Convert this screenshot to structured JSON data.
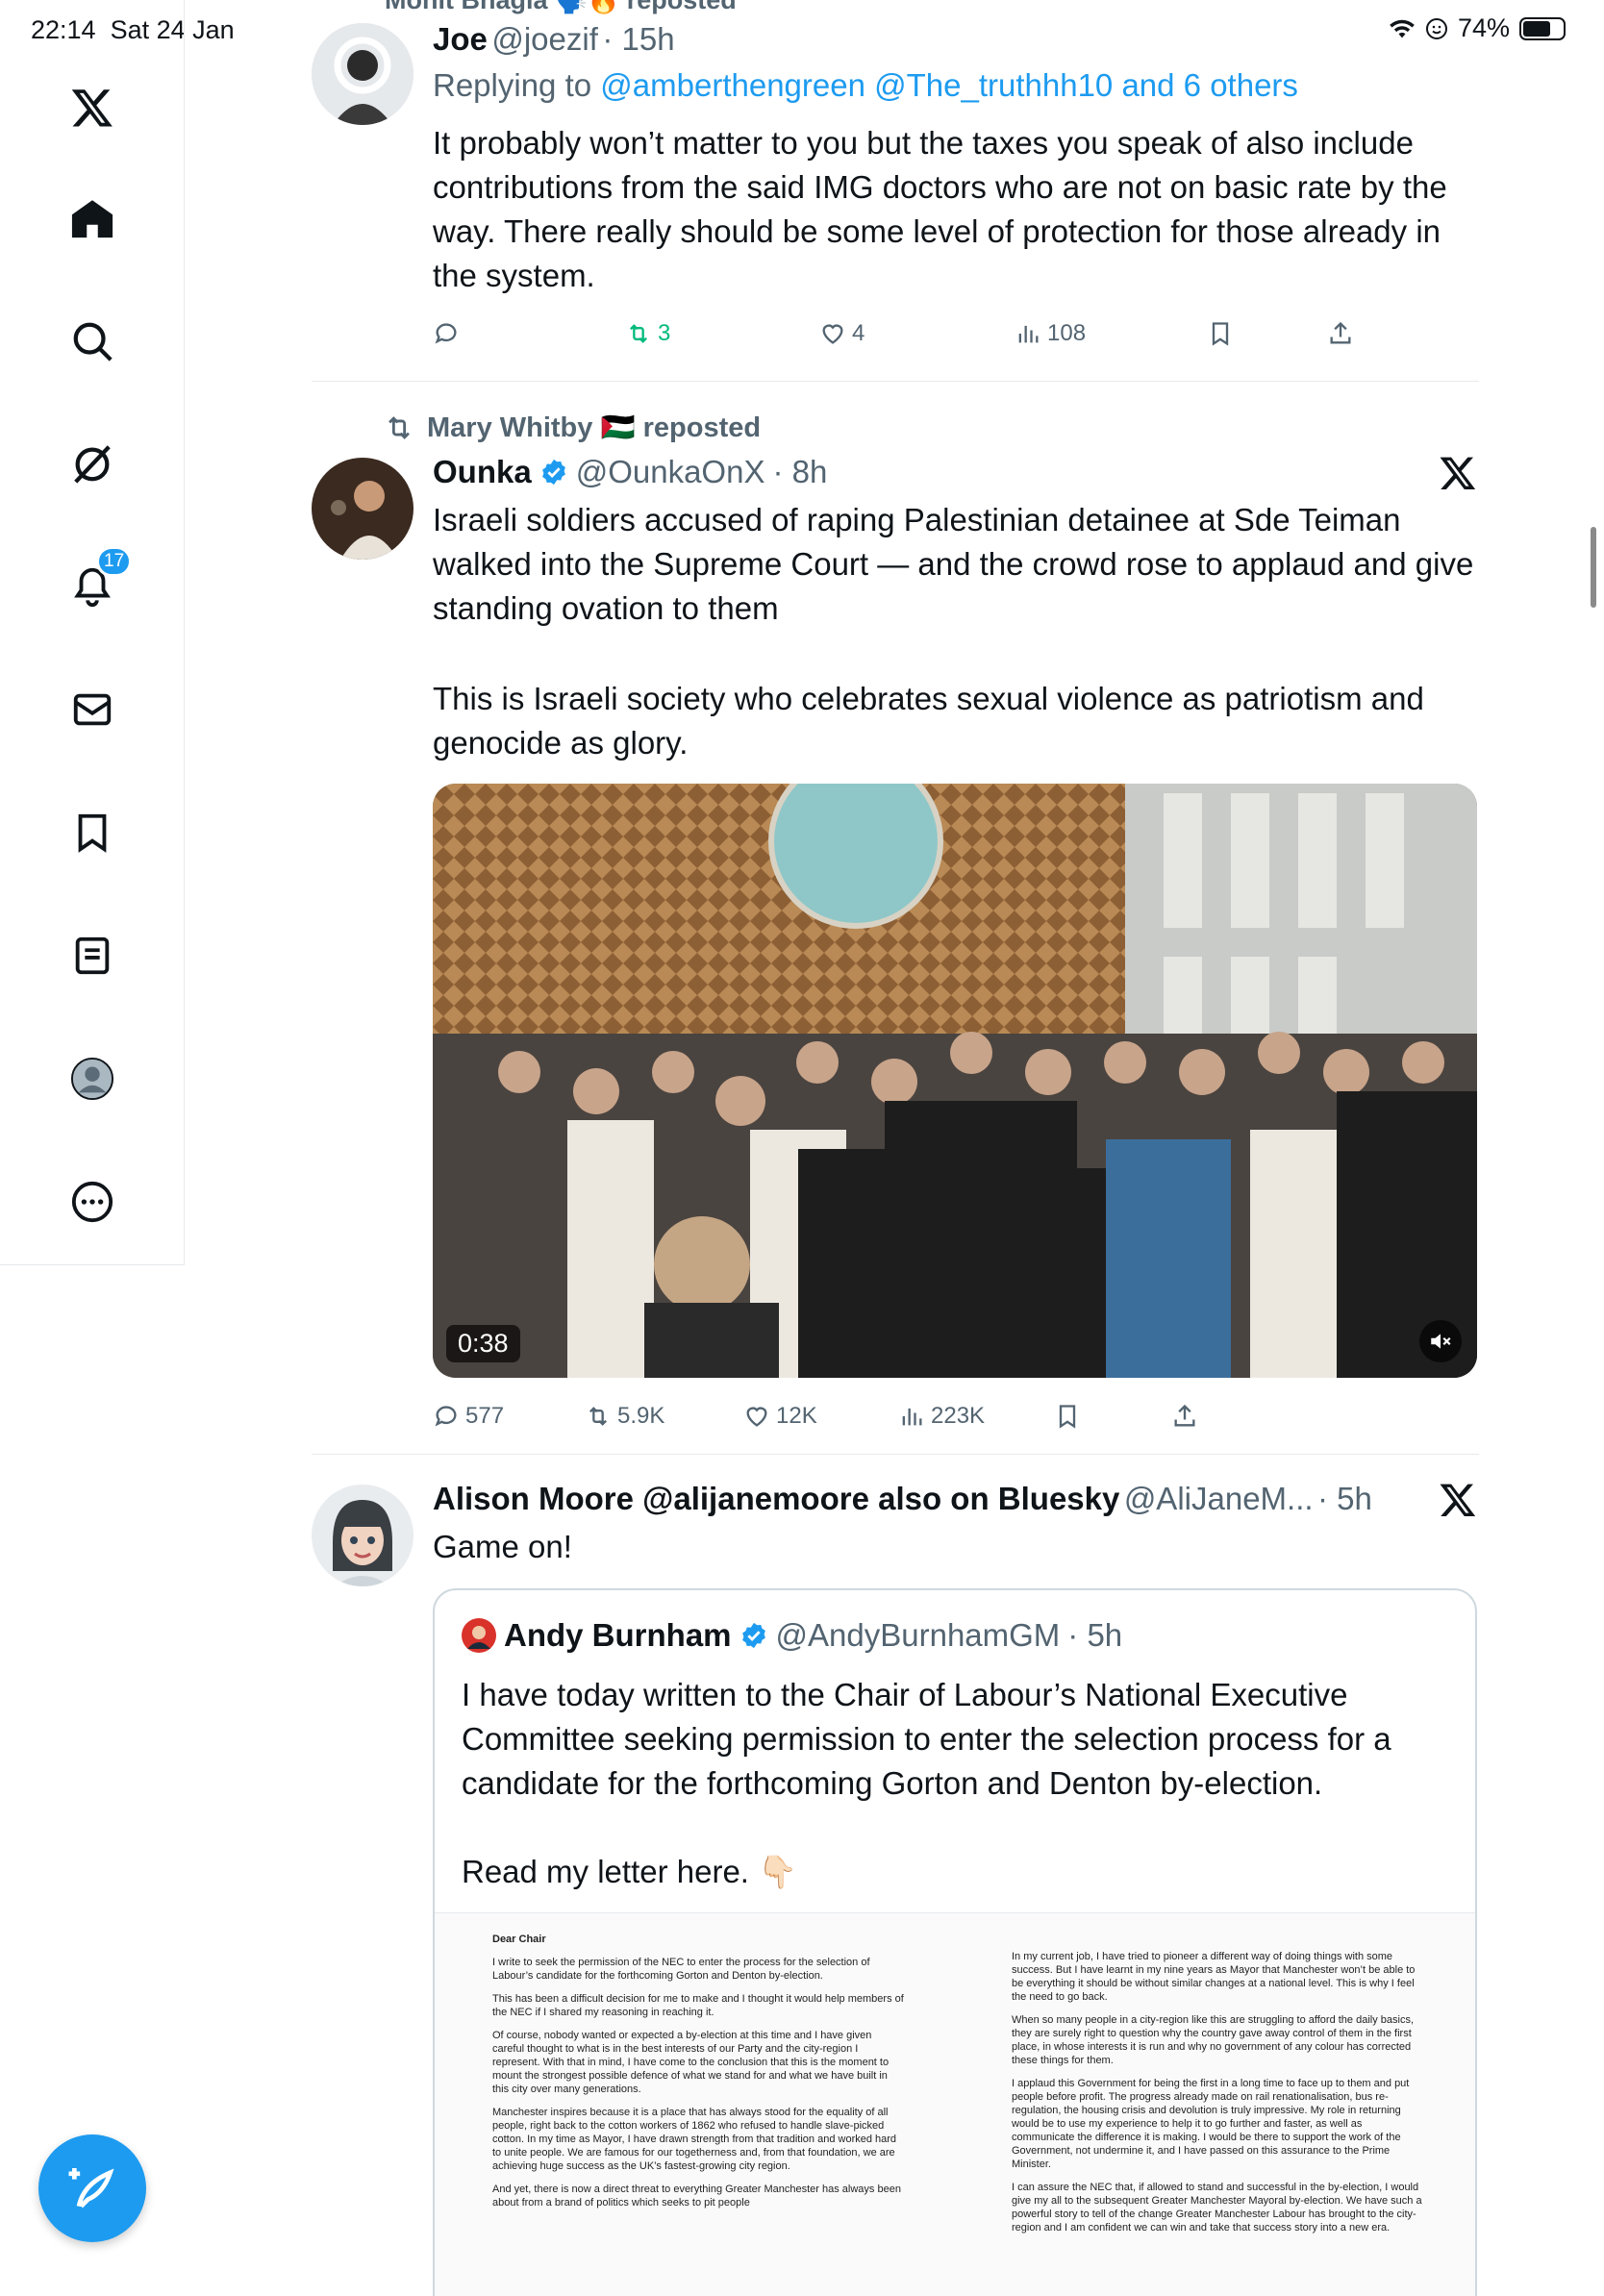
{
  "status_bar": {
    "time": "22:14",
    "date": "Sat 24 Jan",
    "battery": "74%"
  },
  "sidebar": {
    "notification_count": "17"
  },
  "tweet1": {
    "repost_line": "Mohit Bhagia 🗣️🔥 reposted",
    "name": "Joe",
    "handle": "@joezif",
    "time": "· 15h",
    "reply_prefix": "Replying to",
    "reply_to": "@amberthengreen @The_truthhh10 and 6 others",
    "text": "It probably won’t matter to you but the taxes you speak of also include contributions from the said IMG doctors who are not on basic rate by the way. There really should be some level of protection for those already in the system.",
    "retweets": "3",
    "likes": "4",
    "views": "108"
  },
  "tweet2": {
    "repost_line": "Mary Whitby 🇵🇸 reposted",
    "name": "Ounka",
    "handle": "@OunkaOnX",
    "time": "· 8h",
    "text_p1": "Israeli soldiers accused of raping Palestinian detainee at Sde Teiman walked into the Supreme Court — and the crowd rose to applaud and give standing ovation to them",
    "text_p2": "This is Israeli society who celebrates sexual violence as patriotism and genocide as glory.",
    "video_time": "0:38",
    "replies": "577",
    "retweets": "5.9K",
    "likes": "12K",
    "views": "223K"
  },
  "tweet3": {
    "name": "Alison Moore @alijanemoore also on Bluesky",
    "handle": "@AliJaneM...",
    "time": "· 5h",
    "text": "Game on!",
    "quote": {
      "name": "Andy Burnham",
      "handle": "@AndyBurnhamGM",
      "time": "· 5h",
      "text_p1": "I have today written to the Chair of Labour’s National Executive Committee seeking permission to enter the selection process for a candidate for the forthcoming Gorton and Denton by-election.",
      "text_p2": "Read my letter here. 👇🏻",
      "letter_heading": "Dear Chair",
      "letter_left": [
        "I write to seek the permission of the NEC to enter the process for the selection of Labour’s candidate for the forthcoming Gorton and Denton by-election.",
        "This has been a difficult decision for me to make and I thought it would help members of the NEC if I shared my reasoning in reaching it.",
        "Of course, nobody wanted or expected a by-election at this time and I have given careful thought to what is in the best interests of our Party and the city-region I represent. With that in mind, I have come to the conclusion that this is the moment to mount the strongest possible defence of what we stand for and what we have built in this city over many generations.",
        "Manchester inspires because it is a place that has always stood for the equality of all people, right back to the cotton workers of 1862 who refused to handle slave-picked cotton. In my time as Mayor, I have drawn strength from that tradition and worked hard to unite people. We are famous for our togetherness and, from that foundation, we are achieving huge success as the UK’s fastest-growing city region.",
        "And yet, there is now a direct threat to everything Greater Manchester has always been about from a brand of politics which seeks to pit people"
      ],
      "letter_right": [
        "In my current job, I have tried to pioneer a different way of doing things with some success. But I have learnt in my nine years as Mayor that Manchester won’t be able to be everything it should be without similar changes at a national level. This is why I feel the need to go back.",
        "When so many people in a city-region like this are struggling to afford the daily basics, they are surely right to question why the country gave away control of them in the first place, in whose interests it is run and why no government of any colour has corrected these things for them.",
        "I applaud this Government for being the first in a long time to face up to them and put people before profit. The progress already made on rail renationalisation, bus re-regulation, the housing crisis and devolution is truly impressive. My role in returning would be to use my experience to help it to go further and faster, as well as communicate the difference it is making. I would be there to support the work of the Government, not undermine it, and I have passed on this assurance to the Prime Minister.",
        "I can assure the NEC that, if allowed to stand and successful in the by-election, I would give my all to the subsequent Greater Manchester Mayoral by-election. We have such a powerful story to tell of the change Greater Manchester Labour has brought to the city-region and I am confident we can win and take that success story into a new era."
      ]
    }
  },
  "colors": {
    "accent": "#1d9bf0",
    "retweet_green": "#00ba7c",
    "text": "#0f1419",
    "muted": "#536471"
  },
  "icons": [
    "x-logo-icon",
    "home-icon",
    "search-icon",
    "grok-icon",
    "bell-icon",
    "mail-icon",
    "bookmark-icon",
    "lists-icon",
    "profile-icon",
    "more-icon",
    "compose-icon",
    "reply-icon",
    "retweet-icon",
    "like-icon",
    "views-icon",
    "share-icon",
    "verified-icon",
    "mute-icon"
  ]
}
